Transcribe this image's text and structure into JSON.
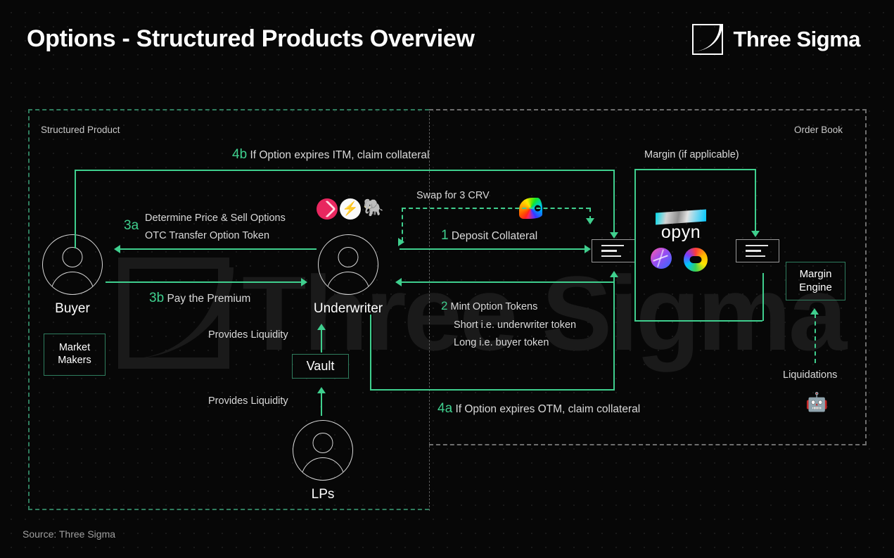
{
  "header": {
    "title": "Options - Structured Products Overview",
    "brand": "Three Sigma",
    "brand_mark_icon": "three-sigma-logo-icon"
  },
  "regions": {
    "left": {
      "label": "Structured Product",
      "color": "#2f7d5e"
    },
    "right": {
      "label": "Order Book",
      "color": "#6e6e6e"
    }
  },
  "actors": {
    "buyer": "Buyer",
    "underwriter": "Underwriter",
    "lps": "LPs"
  },
  "boxes": {
    "market_makers": "Market\nMakers",
    "market_makers_line1": "Market",
    "market_makers_line2": "Makers",
    "vault": "Vault",
    "margin_engine_line1": "Margin",
    "margin_engine_line2": "Engine"
  },
  "flows": {
    "step_4b_num": "4b",
    "step_4b_text": "If Option expires ITM, claim collateral",
    "step_3a_num": "3a",
    "step_3a_line1": "Determine Price & Sell Options",
    "step_3a_line2": "OTC Transfer Option Token",
    "step_3b_num": "3b",
    "step_3b_text": "Pay the Premium",
    "step_1_num": "1",
    "step_1_text": "Deposit Collateral",
    "step_2_num": "2",
    "step_2_line1": "Mint Option Tokens",
    "step_2_line2": "Short i.e. underwriter token",
    "step_2_line3": "Long i.e. buyer token",
    "step_4a_num": "4a",
    "step_4a_text": "If Option expires OTM, claim collateral",
    "swap": "Swap for  3 CRV",
    "margin": "Margin (if applicable)",
    "provides_liquidity_top": "Provides Liquidity",
    "provides_liquidity_bottom": "Provides Liquidity",
    "liquidations": "Liquidations"
  },
  "protocols": {
    "ribbon": "ribbon-protocol-icon",
    "bolt": "thetanuts-bolt-icon",
    "bolt_glyph": "⚡",
    "mammoth": "mammoth-protocol-icon",
    "mammoth_glyph": "🐘",
    "curve": "curve-finance-icon",
    "opyn": "opyn",
    "lyra": "lyra-protocol-icon",
    "dopex": "dopex-protocol-icon",
    "robot_glyph": "🤖"
  },
  "footer": {
    "source": "Source: Three Sigma"
  },
  "colors": {
    "accent_green": "#3fcf8e",
    "region_green": "#2f7d5e",
    "region_gray": "#6e6e6e",
    "background": "#070707",
    "text": "#e8e8e8"
  }
}
